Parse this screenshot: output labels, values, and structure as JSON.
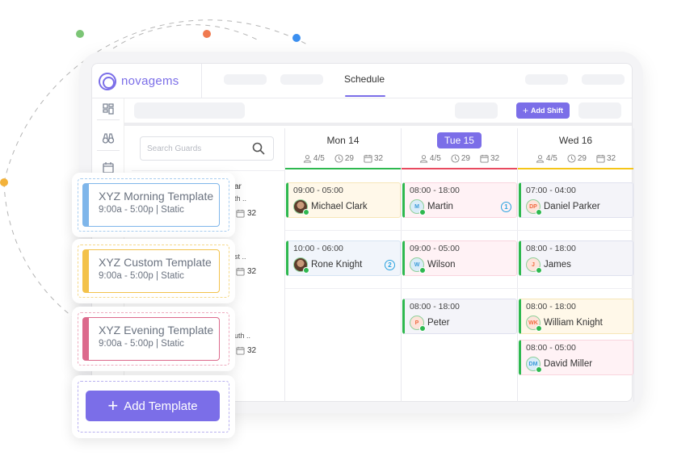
{
  "app": {
    "brand": "novagems",
    "active_nav_tab": "Schedule",
    "brand_color": "#7b6ee8"
  },
  "toolbar": {
    "add_shift_label": "Add Shift"
  },
  "search": {
    "placeholder": "Search Guards"
  },
  "days": [
    {
      "label": "Mon 14",
      "active": false,
      "guards": "4/5",
      "hours": "29",
      "shifts": "32",
      "bar_color": "#2eb84f"
    },
    {
      "label": "Tue 15",
      "active": true,
      "guards": "4/5",
      "hours": "29",
      "shifts": "32",
      "bar_color": "#e84a5f"
    },
    {
      "label": "Wed 16",
      "active": false,
      "guards": "4/5",
      "hours": "29",
      "shifts": "32",
      "bar_color": "#f5c518"
    }
  ],
  "guards_partial": [
    {
      "line1": "ar",
      "line2": "th ..",
      "shifts": "32"
    },
    {
      "line1": "",
      "line2": "st ..",
      "shifts": "32"
    },
    {
      "line1": "",
      "line2": "uth ..",
      "shifts": "32"
    }
  ],
  "shifts": [
    {
      "day": 0,
      "row": 0,
      "time": "09:00 - 05:00",
      "name": "Michael Clark",
      "initials": "",
      "photo": true,
      "count": "",
      "bg": "#fff8e9",
      "border": "#f6e6b8"
    },
    {
      "day": 1,
      "row": 0,
      "time": "08:00 - 18:00",
      "name": "Martin",
      "initials": "M",
      "photo": false,
      "count": "1",
      "bg": "#fff2f5",
      "border": "#f9d5de",
      "av_bg": "#d9ecf8",
      "av_fg": "#3a9ad9"
    },
    {
      "day": 2,
      "row": 0,
      "time": "07:00 - 04:00",
      "name": "Daniel Parker",
      "initials": "DP",
      "photo": false,
      "count": "",
      "bg": "#f4f4f9",
      "border": "#dfe1ee",
      "av_bg": "#fde3da",
      "av_fg": "#f06a3f"
    },
    {
      "day": 0,
      "row": 1,
      "time": "10:00 - 06:00",
      "name": "Rone Knight",
      "initials": "",
      "photo": true,
      "count": "2",
      "bg": "#f1f5fb",
      "border": "#d6e4f3"
    },
    {
      "day": 1,
      "row": 1,
      "time": "09:00 - 05:00",
      "name": "Wilson",
      "initials": "W",
      "photo": false,
      "count": "",
      "bg": "#fff2f5",
      "border": "#f9d5de",
      "av_bg": "#d9ecf8",
      "av_fg": "#3a9ad9"
    },
    {
      "day": 2,
      "row": 1,
      "time": "08:00 - 18:00",
      "name": "James",
      "initials": "J",
      "photo": false,
      "count": "",
      "bg": "#f4f4f9",
      "border": "#dfe1ee",
      "av_bg": "#fde3da",
      "av_fg": "#f06a3f"
    },
    {
      "day": 1,
      "row": 2,
      "time": "08:00 - 18:00",
      "name": "Peter",
      "initials": "P",
      "photo": false,
      "count": "",
      "bg": "#f4f4f9",
      "border": "#dfe1ee",
      "av_bg": "#fde3da",
      "av_fg": "#f06a3f"
    },
    {
      "day": 2,
      "row": 2,
      "time": "08:00 - 18:00",
      "name": "William Knight",
      "initials": "WK",
      "photo": false,
      "count": "",
      "bg": "#fff8e9",
      "border": "#f6e6b8",
      "av_bg": "#fde3da",
      "av_fg": "#f06a3f"
    },
    {
      "day": 2,
      "row": 3,
      "time": "08:00 - 05:00",
      "name": "David Miller",
      "initials": "DM",
      "photo": false,
      "count": "",
      "bg": "#fff2f5",
      "border": "#f9d5de",
      "av_bg": "#d9ecf8",
      "av_fg": "#3a9ad9"
    }
  ],
  "templates": [
    {
      "title": "XYZ Morning Template",
      "subtitle": "9:00a - 5:00p | Static",
      "color": "#7fb6ea",
      "dash": "#a8cdf0"
    },
    {
      "title": "XYZ Custom Template",
      "subtitle": "9:00a - 5:00p | Static",
      "color": "#f3c24b",
      "dash": "#f5d98a"
    },
    {
      "title": "XYZ Evening Template",
      "subtitle": "9:00a - 5:00p | Static",
      "color": "#dc6a8c",
      "dash": "#eeacbf"
    }
  ],
  "add_template": {
    "label": "Add Template"
  }
}
